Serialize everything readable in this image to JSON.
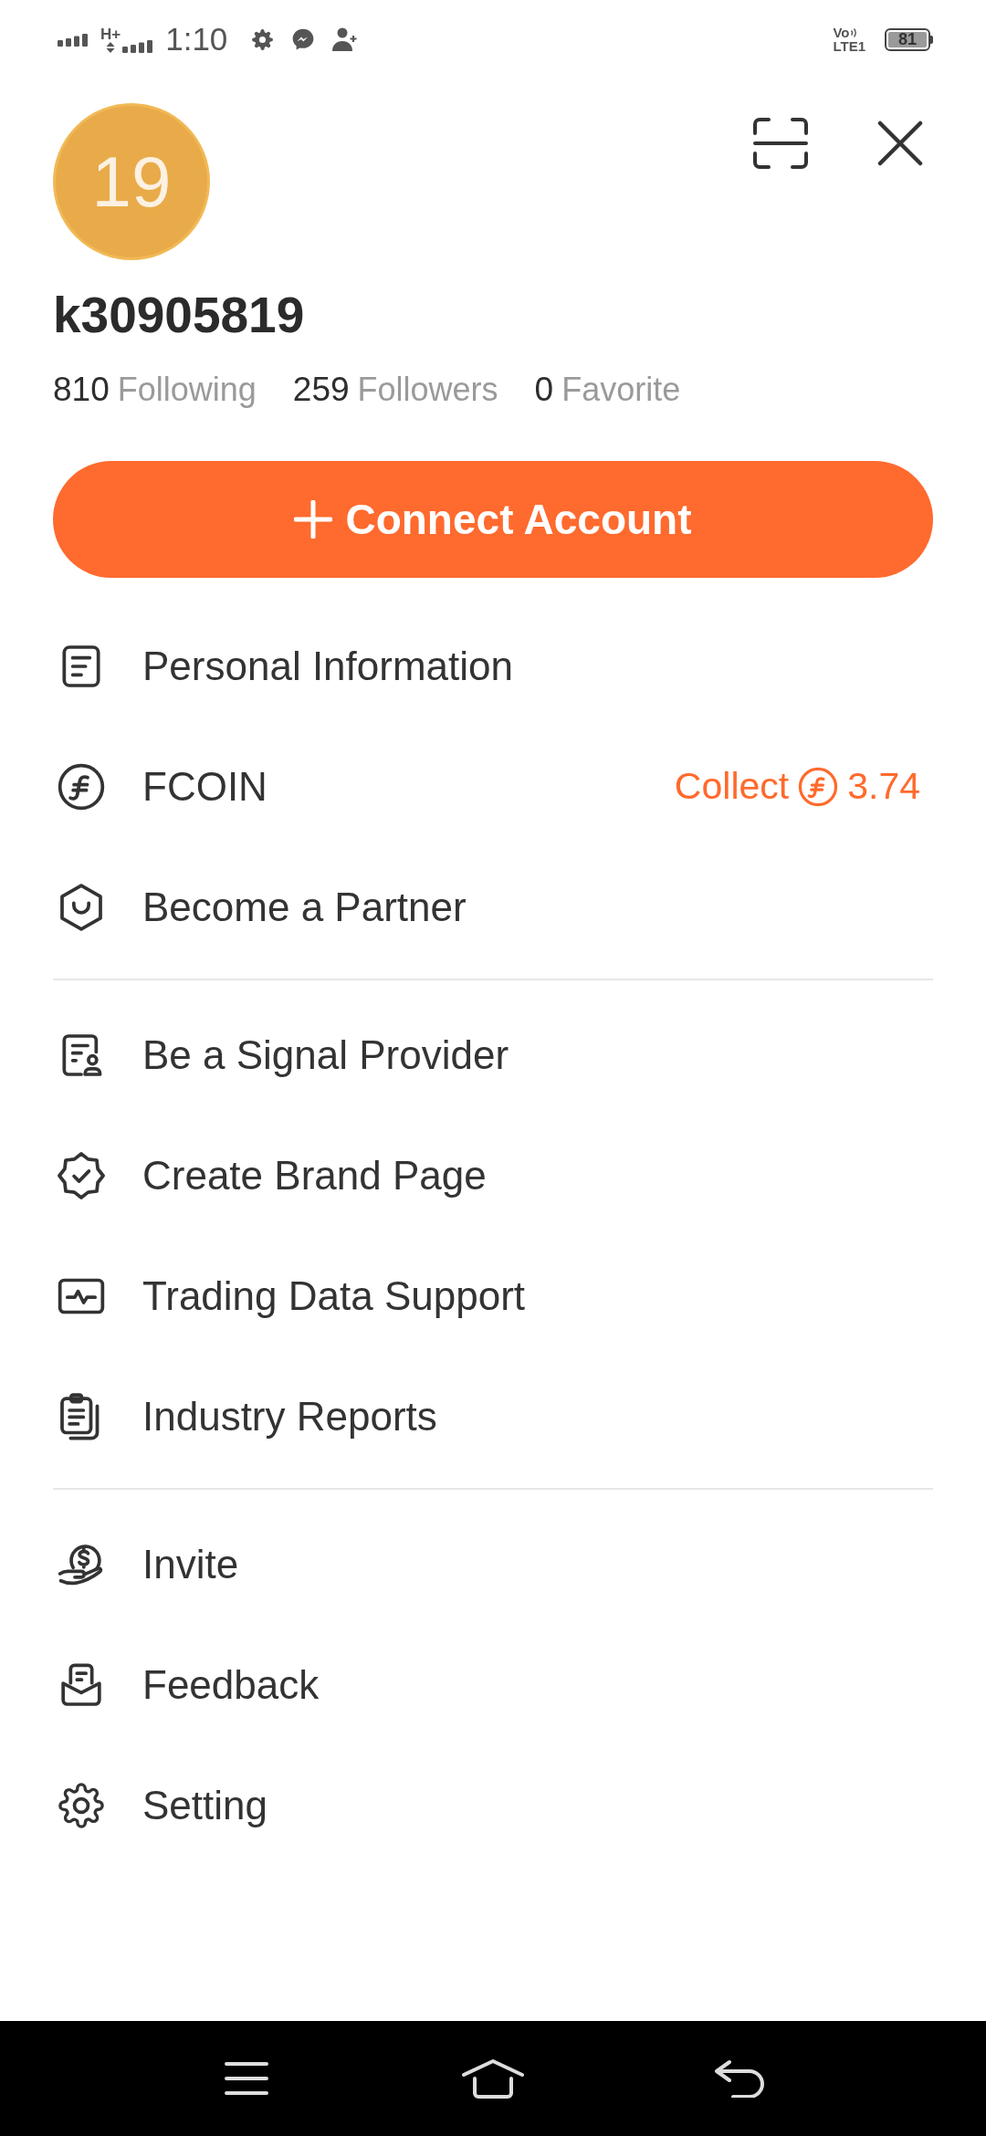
{
  "status_bar": {
    "time": "1:10",
    "network": "H+",
    "volte": "Vo",
    "lte": "LTE1",
    "battery": "81"
  },
  "profile": {
    "avatar": "19",
    "username": "k30905819",
    "stats": [
      {
        "count": "810",
        "label": "Following"
      },
      {
        "count": "259",
        "label": "Followers"
      },
      {
        "count": "0",
        "label": "Favorite"
      }
    ]
  },
  "connect_button": {
    "label": "Connect Account"
  },
  "menu_sections": [
    {
      "items": [
        {
          "label": "Personal Information"
        },
        {
          "label": "FCOIN",
          "collect": {
            "label": "Collect",
            "amount": "3.74"
          }
        },
        {
          "label": "Become a Partner"
        }
      ]
    },
    {
      "items": [
        {
          "label": "Be a Signal Provider"
        },
        {
          "label": "Create Brand Page"
        },
        {
          "label": "Trading Data Support"
        },
        {
          "label": "Industry Reports"
        }
      ]
    },
    {
      "items": [
        {
          "label": "Invite"
        },
        {
          "label": "Feedback"
        },
        {
          "label": "Setting"
        }
      ]
    }
  ]
}
